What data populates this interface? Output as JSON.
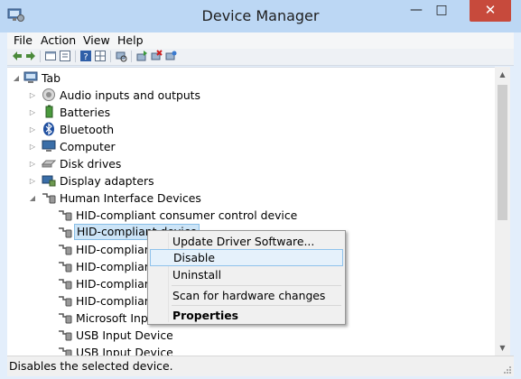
{
  "window": {
    "title": "Device Manager"
  },
  "caption": {
    "minimize": "—",
    "maximize": "□",
    "close": "✕"
  },
  "menu": [
    "File",
    "Action",
    "View",
    "Help"
  ],
  "toolbar_icons": [
    "back-icon",
    "forward-icon",
    "properties-icon",
    "show-hide-icon",
    "help-icon",
    "grid-icon",
    "scan-hardware-icon",
    "update-driver-icon",
    "uninstall-icon",
    "add-legacy-icon"
  ],
  "tree": {
    "root": "Tab",
    "categories": [
      {
        "label": "Audio inputs and outputs"
      },
      {
        "label": "Batteries"
      },
      {
        "label": "Bluetooth"
      },
      {
        "label": "Computer"
      },
      {
        "label": "Disk drives"
      },
      {
        "label": "Display adapters"
      },
      {
        "label": "Human Interface Devices"
      }
    ],
    "hid_children": [
      "HID-compliant consumer control device",
      "HID-compliant device",
      "HID-compliant",
      "HID-compliant",
      "HID-compliant",
      "HID-compliant",
      "Microsoft Inpu",
      "USB Input Device",
      "USB Input Device"
    ]
  },
  "context_menu": {
    "update": "Update Driver Software...",
    "disable": "Disable",
    "uninstall": "Uninstall",
    "scan": "Scan for hardware changes",
    "properties": "Properties"
  },
  "status": {
    "text": "Disables the selected device."
  },
  "colors": {
    "title_bar": "#bcd7f4",
    "close_button": "#c74a3c",
    "selection": "#cce4f7",
    "menu_highlight": "#e5f1fb"
  }
}
